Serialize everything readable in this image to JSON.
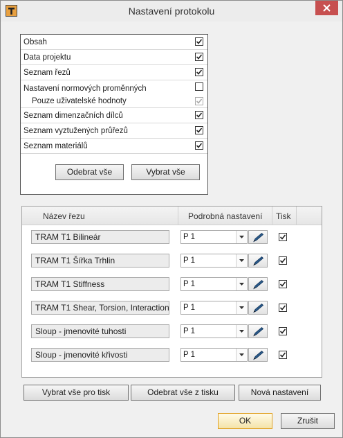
{
  "window": {
    "title": "Nastavení protokolu"
  },
  "sections": [
    {
      "label": "Obsah",
      "checked": true,
      "disabled": false
    },
    {
      "label": "Data projektu",
      "checked": true,
      "disabled": false
    },
    {
      "label": "Seznam řezů",
      "checked": true,
      "disabled": false
    },
    {
      "label": "Nastavení normových proměnných",
      "checked": false,
      "disabled": false
    },
    {
      "label": "Pouze uživatelské hodnoty",
      "checked": true,
      "disabled": true
    },
    {
      "label": "Seznam dimenzačních dílců",
      "checked": true,
      "disabled": false
    },
    {
      "label": "Seznam vyztužených průřezů",
      "checked": true,
      "disabled": false
    },
    {
      "label": "Seznam materiálů",
      "checked": true,
      "disabled": false
    }
  ],
  "top_buttons": {
    "deselect_all": "Odebrat vše",
    "select_all": "Vybrat vše"
  },
  "grid": {
    "headers": {
      "name": "Název řezu",
      "settings": "Podrobná nastavení",
      "print": "Tisk"
    },
    "rows": [
      {
        "name": "TRAM T1 Bilineár",
        "setting": "P 1",
        "print": true
      },
      {
        "name": "TRAM T1  Šířka Trhlin",
        "setting": "P 1",
        "print": true
      },
      {
        "name": "TRAM T1  Stiffness",
        "setting": "P 1",
        "print": true
      },
      {
        "name": "TRAM T1 Shear, Torsion, Interaction",
        "setting": "P 1",
        "print": true
      },
      {
        "name": "Sloup - jmenovité tuhosti",
        "setting": "P 1",
        "print": true
      },
      {
        "name": "Sloup - jmenovité křivosti",
        "setting": "P 1",
        "print": true
      }
    ]
  },
  "bottom_buttons": {
    "select_all_print": "Vybrat vše pro tisk",
    "remove_all_print": "Odebrat vše z tisku",
    "new_settings": "Nová nastavení",
    "ok": "OK",
    "cancel": "Zrušit"
  }
}
